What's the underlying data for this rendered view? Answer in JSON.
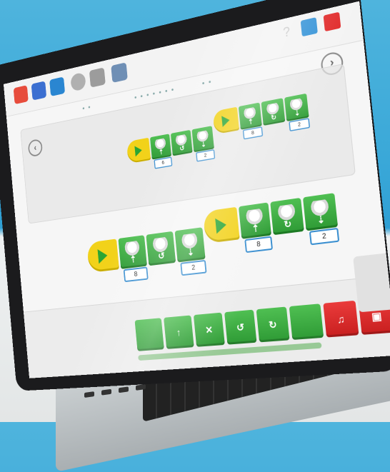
{
  "scene": {
    "background_color": "#3aa8d8",
    "desk_color": "#e6e8e8"
  },
  "toolbar": {
    "tools": [
      {
        "icon": "home-icon",
        "color": "#e74c3c"
      },
      {
        "icon": "bricks-icon",
        "color": "#3b6fd1"
      },
      {
        "icon": "book-icon",
        "color": "#2a86d1"
      },
      {
        "icon": "gear-icon",
        "color": "#b0b0b0"
      },
      {
        "icon": "camera-icon",
        "color": "#9c9c9c"
      },
      {
        "icon": "document-icon",
        "color": "#6f8fb5"
      }
    ],
    "window_buttons": [
      {
        "icon": "help-icon",
        "color": "#c9c9c9",
        "label": "?"
      },
      {
        "icon": "blue-square-icon",
        "color": "#2d8fd6",
        "label": ""
      },
      {
        "icon": "close-icon",
        "color": "#e02424",
        "label": ""
      }
    ]
  },
  "programs": [
    {
      "blocks": [
        {
          "glyph": "⇡",
          "param": "6"
        },
        {
          "glyph": "↺",
          "param": ""
        },
        {
          "glyph": "⇣",
          "param": "2"
        }
      ]
    },
    {
      "blocks": [
        {
          "glyph": "⇡",
          "param": "8"
        },
        {
          "glyph": "↻",
          "param": ""
        },
        {
          "glyph": "⇣",
          "param": "2"
        }
      ]
    },
    {
      "blocks": [
        {
          "glyph": "⇡",
          "param": "8"
        },
        {
          "glyph": "↺",
          "param": ""
        },
        {
          "glyph": "⇣",
          "param": "2"
        }
      ]
    },
    {
      "blocks": [
        {
          "glyph": "⇡",
          "param": "8"
        },
        {
          "glyph": "↻",
          "param": ""
        },
        {
          "glyph": "⇣",
          "param": "2"
        }
      ]
    }
  ],
  "palette": {
    "items": [
      {
        "icon": "motor-icon",
        "color": "green",
        "glyph": ""
      },
      {
        "icon": "motor-up-icon",
        "color": "green",
        "glyph": "↑"
      },
      {
        "icon": "motor-stop-icon",
        "color": "green",
        "glyph": "✕"
      },
      {
        "icon": "motor-left-icon",
        "color": "green",
        "glyph": "↺"
      },
      {
        "icon": "motor-right-icon",
        "color": "green",
        "glyph": "↻"
      },
      {
        "icon": "light-icon",
        "color": "green",
        "glyph": ""
      },
      {
        "icon": "sound-icon",
        "color": "red",
        "glyph": "♫"
      },
      {
        "icon": "display-icon",
        "color": "red",
        "glyph": "▣"
      },
      {
        "icon": "red-block-icon",
        "color": "red",
        "glyph": ""
      }
    ]
  }
}
